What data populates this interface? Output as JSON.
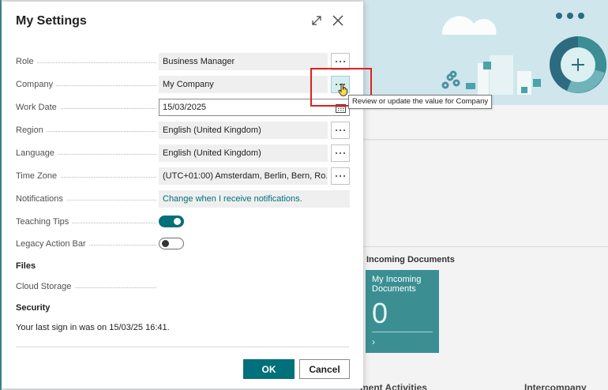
{
  "dialog": {
    "title": "My Settings",
    "expand_icon": "expand-diagonal-icon",
    "close_icon": "close-x-icon"
  },
  "fields": {
    "role": {
      "label": "Role",
      "value": "Business Manager"
    },
    "company": {
      "label": "Company",
      "value": "My Company"
    },
    "work_date": {
      "label": "Work Date",
      "value": "15/03/2025"
    },
    "region": {
      "label": "Region",
      "value": "English (United Kingdom)"
    },
    "language": {
      "label": "Language",
      "value": "English (United Kingdom)"
    },
    "time_zone": {
      "label": "Time Zone",
      "value": "(UTC+01:00) Amsterdam, Berlin, Bern, Ro..."
    },
    "notifications": {
      "label": "Notifications",
      "value": "Change when I receive notifications."
    },
    "teaching_tips": {
      "label": "Teaching Tips",
      "on": true
    },
    "legacy_action_bar": {
      "label": "Legacy Action Bar",
      "on": false
    }
  },
  "files": {
    "heading": "Files",
    "cloud_storage_label": "Cloud Storage"
  },
  "security": {
    "heading": "Security",
    "last_sign_in": "Your last sign in was on 15/03/25 16:41."
  },
  "buttons": {
    "ok": "OK",
    "cancel": "Cancel"
  },
  "tooltip": {
    "text": "Review or update the value for Company"
  },
  "background": {
    "section_title": "Incoming Documents",
    "tile_title": "My Incoming Documents",
    "tile_count": "0",
    "bottom_left_cut": "ment Activities",
    "bottom_right_cut": "Intercompany"
  },
  "colors": {
    "accent": "#00707a",
    "tile": "#3b8f93",
    "highlight": "#e0201f"
  }
}
